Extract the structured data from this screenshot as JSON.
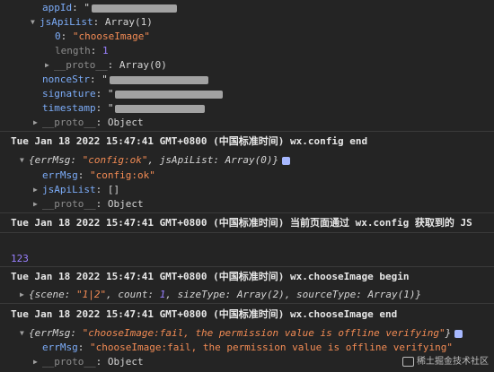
{
  "lines": {
    "appId_key": "appId",
    "jsApiList_key": "jsApiList",
    "jsApiList_val": "Array(1)",
    "item0_key": "0",
    "item0_val": "\"chooseImage\"",
    "length_key": "length",
    "length_val": "1",
    "proto_key": "__proto__",
    "proto_array0": "Array(0)",
    "nonceStr_key": "nonceStr",
    "signature_key": "signature",
    "timestamp_key": "timestamp",
    "proto_object": "Object"
  },
  "logs": {
    "config_end": "Tue Jan 18 2022 15:47:41 GMT+0800 (中国标准时间) wx.config end",
    "config_obj_open": "{errMsg: ",
    "config_errmsg_val": "\"config:ok\"",
    "config_obj_mid": ", jsApiList: ",
    "config_obj_arr": "Array(0)",
    "config_obj_close": "}",
    "errMsg_key": "errMsg",
    "config_errmsg_expanded": "\"config:ok\"",
    "jsApiList_key": "jsApiList",
    "empty_array": "[]",
    "proto_key": "__proto__",
    "proto_object": "Object",
    "page_notice": "Tue Jan 18 2022 15:47:41 GMT+0800 (中国标准时间) 当前页面通过 wx.config 获取到的 JS",
    "number_line": "123",
    "choose_begin": "Tue Jan 18 2022 15:47:41 GMT+0800 (中国标准时间) wx.chooseImage begin",
    "choose_obj_open": "{scene: ",
    "scene_val": "\"1|2\"",
    "count_part": ", count: ",
    "count_val": "1",
    "sizeType_part": ", sizeType: ",
    "sizeType_val": "Array(2)",
    "sourceType_part": ", sourceType: ",
    "sourceType_val": "Array(1)",
    "choose_obj_close": "}",
    "choose_end": "Tue Jan 18 2022 15:47:41 GMT+0800 (中国标准时间) wx.chooseImage end",
    "fail_obj_open": "{errMsg: ",
    "fail_msg": "\"chooseImage:fail, the permission value is offline verifying\"",
    "fail_obj_close": "}",
    "fail_errmsg_key": "errMsg",
    "fail_errmsg_val": "\"chooseImage:fail, the permission value is offline verifying\"",
    "fail_proto_key": "__proto__",
    "fail_proto_val": "Object"
  },
  "watermark": "稀土掘金技术社区",
  "colors": {
    "background": "#242424",
    "property": "#7cacf8",
    "string": "#f28b54",
    "number": "#9980ff"
  }
}
